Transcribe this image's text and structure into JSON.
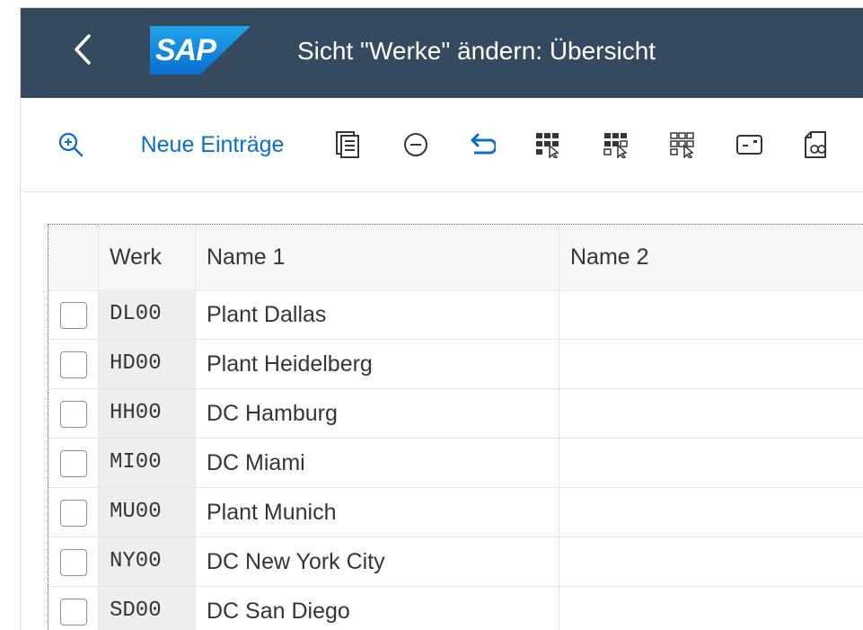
{
  "shell": {
    "logo_text": "SAP",
    "title": "Sicht \"Werke\" ändern: Übersicht",
    "colors": {
      "header_bg": "#354a5f",
      "logo_blue": "#1a8fd6"
    }
  },
  "toolbar": {
    "find_icon": "search-zoom-icon",
    "new_entries_label": "Neue Einträge",
    "icons": [
      "copy-as-icon",
      "delete-icon",
      "undo-icon",
      "select-all-icon",
      "select-block-icon",
      "deselect-all-icon",
      "print-preview-icon",
      "display-document-icon"
    ],
    "accent_color": "#0a6ed1"
  },
  "table": {
    "columns": [
      "Werk",
      "Name 1",
      "Name 2"
    ],
    "rows": [
      {
        "werk": "DL00",
        "name1": "Plant Dallas",
        "name2": ""
      },
      {
        "werk": "HD00",
        "name1": "Plant Heidelberg",
        "name2": ""
      },
      {
        "werk": "HH00",
        "name1": "DC Hamburg",
        "name2": ""
      },
      {
        "werk": "MI00",
        "name1": "DC Miami",
        "name2": ""
      },
      {
        "werk": "MU00",
        "name1": "Plant Munich",
        "name2": ""
      },
      {
        "werk": "NY00",
        "name1": "DC New York City",
        "name2": ""
      },
      {
        "werk": "SD00",
        "name1": "DC San Diego",
        "name2": ""
      }
    ]
  }
}
